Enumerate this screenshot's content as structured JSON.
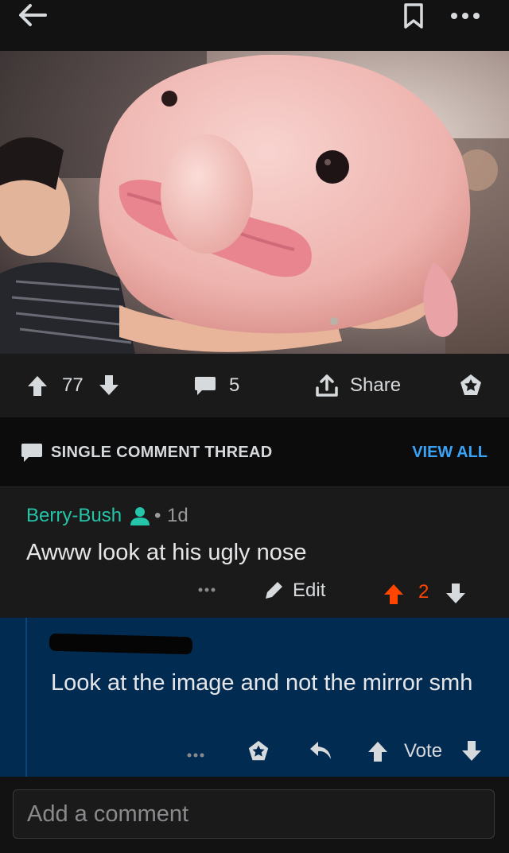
{
  "post": {
    "upvotes": "77",
    "comments": "5",
    "share_label": "Share"
  },
  "thread": {
    "title": "SINGLE COMMENT THREAD",
    "view_all": "VIEW ALL"
  },
  "comment": {
    "author": "Berry-Bush",
    "age": "1d",
    "body": "Awww look at his ugly nose",
    "edit_label": "Edit",
    "score": "2"
  },
  "reply": {
    "body": "Look at the image and not the mirror smh",
    "vote_label": "Vote"
  },
  "composer": {
    "placeholder": "Add a comment"
  },
  "colors": {
    "background": "#121213",
    "panel": "#1a1a1b",
    "accent_blue": "#3aa3f5",
    "author_green": "#24c5a8",
    "upvote_orange": "#ff4500",
    "reply_bg": "#022b52"
  },
  "icons": [
    "back-arrow-icon",
    "bookmark-icon",
    "more-icon",
    "upvote-icon",
    "downvote-icon",
    "comment-icon",
    "share-icon",
    "award-icon",
    "user-icon",
    "pencil-icon",
    "reply-icon"
  ]
}
